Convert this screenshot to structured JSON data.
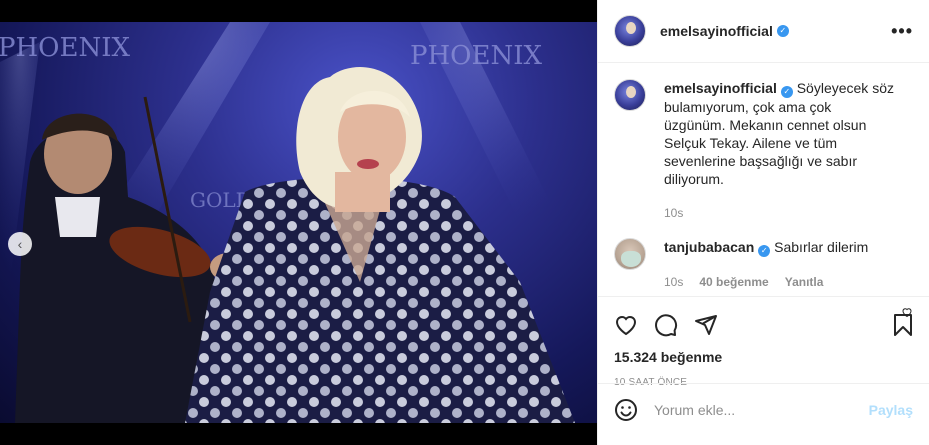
{
  "post": {
    "author": "emelsayinofficial",
    "verified_badge": "✓",
    "caption": "Söyleyecek söz bulamıyorum, çok ama çok üzgünüm. Mekanın cennet olsun Selçuk Tekay. Ailene ve tüm sevenlerine başsağlığı ve sabır diliyorum.",
    "caption_time": "10s",
    "likes": "15.324 beğenme",
    "posted_ago": "10 saat önce"
  },
  "comments": [
    {
      "user": "tanjubabacan",
      "text": "Sabırlar dilerim",
      "time": "10s",
      "likes": "40 beğenme",
      "reply": "Yanıtla"
    }
  ],
  "composer": {
    "placeholder": "Yorum ekle...",
    "post_label": "Paylaş"
  },
  "photo_text": {
    "left_sign": "PHOENIX",
    "right_sign": "PHOENIX",
    "center_sign": "GOLDEN PHOENIX"
  },
  "carousel": {
    "count": 2,
    "active_index": 1
  },
  "icons": [
    "more-icon",
    "heart-icon",
    "comment-icon",
    "share-icon",
    "bookmark-icon",
    "emoji-icon",
    "chevron-left-icon"
  ],
  "colors": {
    "accent": "#3897f0",
    "post_disabled": "#b2dffc",
    "muted": "#8e8e8e"
  }
}
